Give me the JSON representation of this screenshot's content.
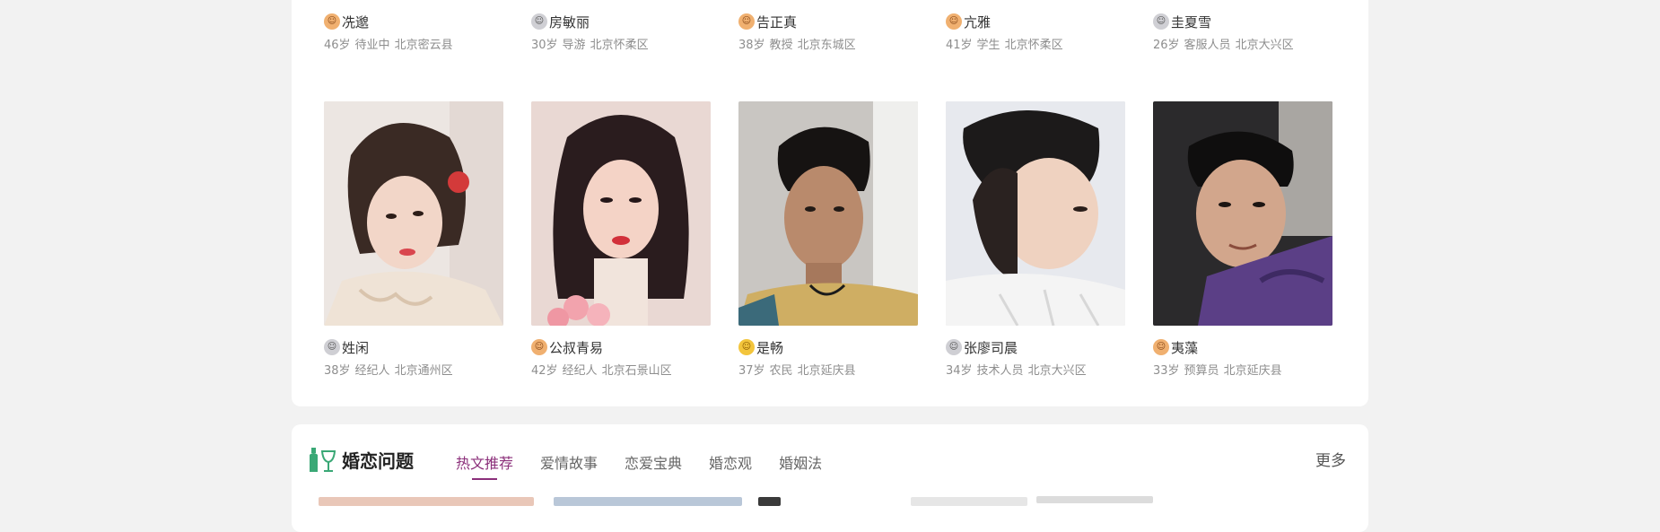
{
  "profiles_row1": [
    {
      "name": "冼邈",
      "age": "46岁",
      "job": "待业中",
      "location": "北京密云县",
      "gender": "female"
    },
    {
      "name": "房敏丽",
      "age": "30岁",
      "job": "导游",
      "location": "北京怀柔区",
      "gender": "male"
    },
    {
      "name": "告正真",
      "age": "38岁",
      "job": "教授",
      "location": "北京东城区",
      "gender": "female"
    },
    {
      "name": "亢雅",
      "age": "41岁",
      "job": "学生",
      "location": "北京怀柔区",
      "gender": "female"
    },
    {
      "name": "圭夏雪",
      "age": "26岁",
      "job": "客服人员",
      "location": "北京大兴区",
      "gender": "male"
    }
  ],
  "profiles_row2": [
    {
      "name": "姓闲",
      "age": "38岁",
      "job": "经纪人",
      "location": "北京通州区",
      "gender": "male"
    },
    {
      "name": "公叔青易",
      "age": "42岁",
      "job": "经纪人",
      "location": "北京石景山区",
      "gender": "female"
    },
    {
      "name": "是畅",
      "age": "37岁",
      "job": "农民",
      "location": "北京延庆县",
      "gender": "gold"
    },
    {
      "name": "张廖司晨",
      "age": "34岁",
      "job": "技术人员",
      "location": "北京大兴区",
      "gender": "male"
    },
    {
      "name": "夷藻",
      "age": "33岁",
      "job": "预算员",
      "location": "北京延庆县",
      "gender": "female"
    }
  ],
  "topic_section": {
    "title": "婚恋问题",
    "tabs": [
      "热文推荐",
      "爱情故事",
      "恋爱宝典",
      "婚恋观",
      "婚姻法"
    ],
    "more_label": "更多",
    "accent_color": "#8b2f7a",
    "icon": "wine-bottle-glass-icon"
  }
}
